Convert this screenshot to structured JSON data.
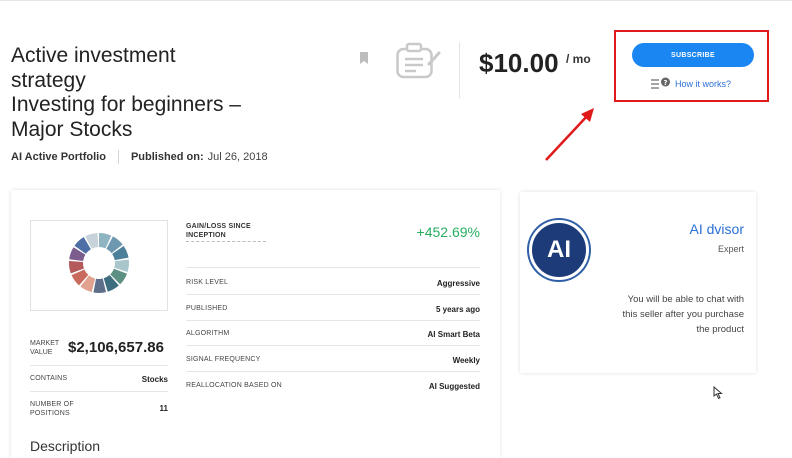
{
  "header": {
    "title_line1": "Active investment",
    "title_line2": "strategy",
    "title_line3": "Investing for beginners –",
    "title_line4": "Major Stocks",
    "author": "AI Active Portfolio",
    "published_label": "Published on:",
    "published_date": "Jul 26, 2018",
    "price": "$10.00",
    "price_period": "/ mo",
    "subscribe_label": "SUBSCRIBE",
    "how_it_works": "How it works?"
  },
  "stats": {
    "gain_loss_label": "GAIN/LOSS SINCE INCEPTION",
    "gain_loss_value": "+452.69%",
    "market_value_label": "MARKET VALUE",
    "market_value": "$2,106,657.86",
    "rows_left": [
      {
        "label": "CONTAINS",
        "value": "Stocks"
      },
      {
        "label": "NUMBER OF POSITIONS",
        "value": "11"
      }
    ],
    "rows_right": [
      {
        "label": "RISK LEVEL",
        "value": "Aggressive"
      },
      {
        "label": "PUBLISHED",
        "value": "5 years ago"
      },
      {
        "label": "ALGORITHM",
        "value": "AI Smart Beta"
      },
      {
        "label": "SIGNAL FREQUENCY",
        "value": "Weekly"
      },
      {
        "label": "REALLOCATION BASED ON",
        "value": "AI Suggested"
      }
    ],
    "description_title": "Description"
  },
  "donut_colors": [
    "#8fb5c2",
    "#6e97b0",
    "#4c7f99",
    "#a9c6cc",
    "#5d8f83",
    "#3f6d80",
    "#5e6f8c",
    "#e1a38f",
    "#c96a5e",
    "#b55a5a",
    "#7b5d8e",
    "#4d6fa5",
    "#c7d2da"
  ],
  "advisor": {
    "avatar_text": "AI",
    "name": "AI dvisor",
    "role": "Expert",
    "note": "You will be able to chat with this seller after you purchase the product"
  },
  "colors": {
    "accent": "#1a86f2",
    "gain": "#27ae60",
    "highlight": "#e0191b",
    "avatar_bg": "#1d3b78"
  }
}
